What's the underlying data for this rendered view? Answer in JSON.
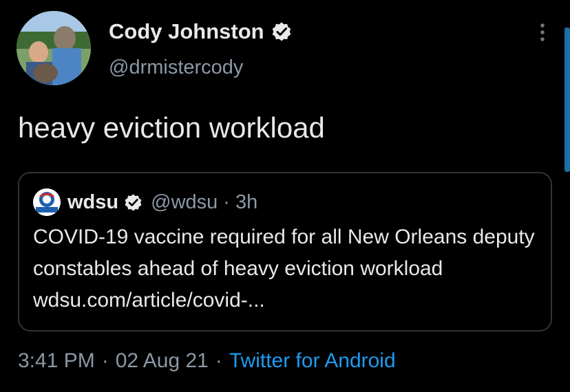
{
  "author": {
    "display_name": "Cody Johnston",
    "handle": "@drmistercody",
    "avatar_icon": "profile-photo",
    "verified_icon": "verified-badge-icon"
  },
  "tweet": {
    "text": "heavy eviction workload"
  },
  "quoted_tweet": {
    "display_name": "wdsu",
    "handle": "@wdsu",
    "separator": "·",
    "time": "3h",
    "text": "COVID-19 vaccine required for all New Orleans deputy constables ahead of heavy eviction workload wdsu.com/article/covid-...",
    "avatar_icon": "wdsu-logo"
  },
  "meta": {
    "time": "3:41 PM",
    "sep1": "·",
    "date": "02 Aug 21",
    "sep2": "·",
    "source": "Twitter for Android"
  },
  "colors": {
    "background": "#000000",
    "primary_text": "#e7e9ea",
    "secondary_text": "#8b98a5",
    "link": "#1d9bf0",
    "border": "#2f3336"
  }
}
